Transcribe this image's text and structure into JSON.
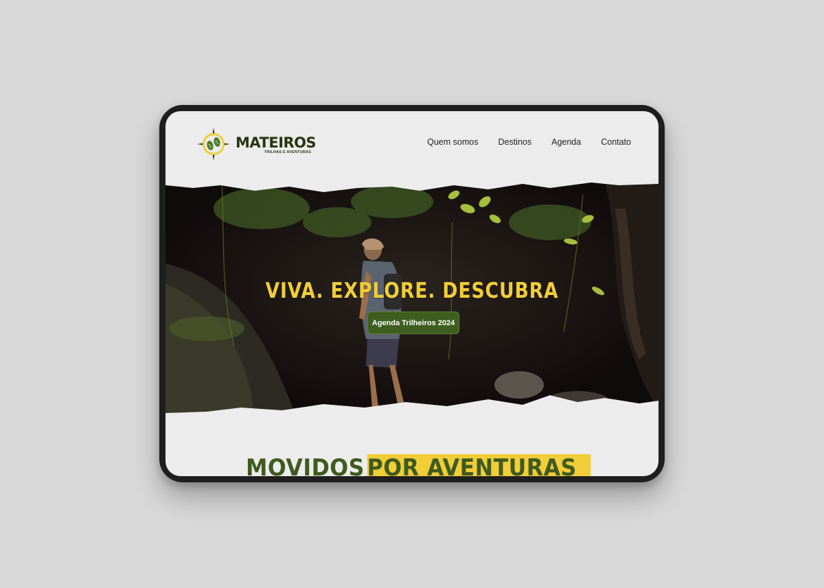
{
  "brand": {
    "name": "MATEIROS",
    "tagline": "TRILHAS E AVENTURAS",
    "logo_icon": "compass-footprints-icon"
  },
  "nav": {
    "items": [
      {
        "label": "Quem somos"
      },
      {
        "label": "Destinos"
      },
      {
        "label": "Agenda"
      },
      {
        "label": "Contato"
      }
    ]
  },
  "hero": {
    "title": "VIVA. EXPLORE. DESCUBRA",
    "cta_label": "Agenda Trilheiros 2024",
    "image": "hiker-in-jungle-photo"
  },
  "section": {
    "title_part1": "MOVIDOS",
    "title_part2": "POR AVENTURAS"
  },
  "colors": {
    "accent_yellow": "#f1cd37",
    "brand_green": "#3d5e1f",
    "background": "#ececec",
    "device_frame": "#1e1e1e"
  }
}
